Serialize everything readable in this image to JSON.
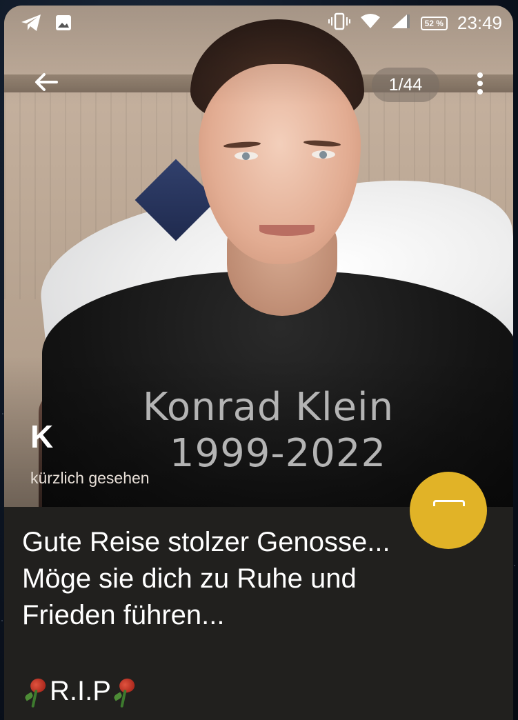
{
  "status_bar": {
    "time": "23:49",
    "battery": "52 %"
  },
  "nav": {
    "photo_counter": "1/44"
  },
  "photo_overlay": {
    "name": "Konrad Klein",
    "years": "1999-2022"
  },
  "profile": {
    "initial": "K",
    "last_seen": "kürzlich gesehen"
  },
  "caption": {
    "lines": [
      "Gute Reise stolzer Genosse...",
      "Möge sie dich zu Ruhe und",
      "Frieden führen..."
    ],
    "rip": "R.I.P"
  },
  "icons": {
    "status_left": [
      "telegram-icon",
      "image-icon"
    ],
    "status_right": [
      "vibrate-icon",
      "wifi-icon",
      "signal-icon",
      "battery-icon"
    ],
    "fab": "message-icon"
  },
  "colors": {
    "fab": "#e1b327",
    "caption_background": "#21201e"
  }
}
